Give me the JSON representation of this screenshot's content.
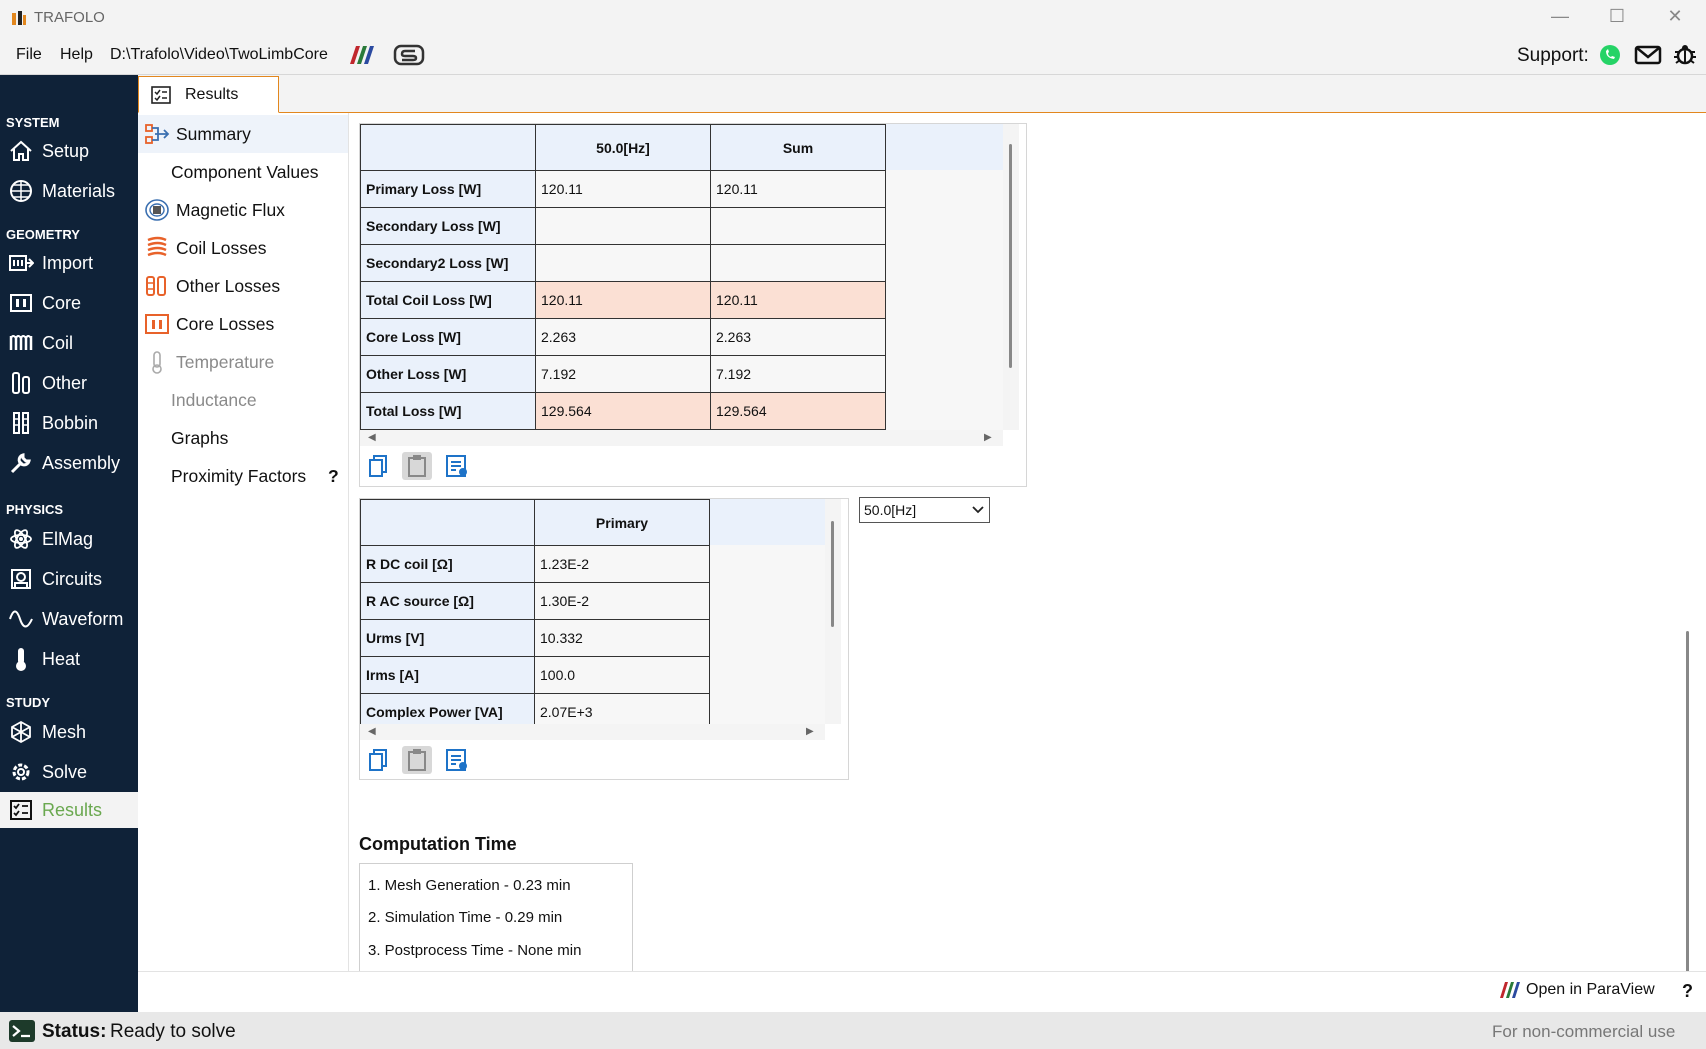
{
  "window": {
    "app_title": "TRAFOLO",
    "minimize": "—",
    "maximize": "☐",
    "close": "✕"
  },
  "menu": {
    "file": "File",
    "help": "Help",
    "path": "D:\\Trafolo\\Video\\TwoLimbCore",
    "support_label": "Support:"
  },
  "sidebar": {
    "sections": {
      "system": "SYSTEM",
      "geometry": "GEOMETRY",
      "physics": "PHYSICS",
      "study": "STUDY"
    },
    "items": {
      "setup": "Setup",
      "materials": "Materials",
      "import": "Import",
      "core": "Core",
      "coil": "Coil",
      "other": "Other",
      "bobbin": "Bobbin",
      "assembly": "Assembly",
      "elmag": "ElMag",
      "circuits": "Circuits",
      "waveform": "Waveform",
      "heat": "Heat",
      "mesh": "Mesh",
      "solve": "Solve",
      "results": "Results"
    }
  },
  "tab": {
    "label": "Results"
  },
  "subnav": {
    "summary": "Summary",
    "component_values": "Component Values",
    "magnetic_flux": "Magnetic Flux",
    "coil_losses": "Coil Losses",
    "other_losses": "Other Losses",
    "core_losses": "Core Losses",
    "temperature": "Temperature",
    "inductance": "Inductance",
    "graphs": "Graphs",
    "proximity_factors": "Proximity Factors",
    "help_mark": "?"
  },
  "loss_table": {
    "headers": [
      "50.0[Hz]",
      "Sum"
    ],
    "rows": [
      {
        "label": "Primary Loss [W]",
        "v1": "120.11",
        "v2": "120.11"
      },
      {
        "label": "Secondary Loss [W]",
        "v1": "",
        "v2": ""
      },
      {
        "label": "Secondary2 Loss [W]",
        "v1": "",
        "v2": ""
      },
      {
        "label": "Total Coil Loss [W]",
        "v1": "120.11",
        "v2": "120.11"
      },
      {
        "label": "Core Loss [W]",
        "v1": "2.263",
        "v2": "2.263"
      },
      {
        "label": "Other Loss [W]",
        "v1": "7.192",
        "v2": "7.192"
      },
      {
        "label": "Total Loss [W]",
        "v1": "129.564",
        "v2": "129.564"
      }
    ]
  },
  "component_table": {
    "headers": [
      "Primary"
    ],
    "rows": [
      {
        "label": "R DC coil [Ω]",
        "v1": "1.23E-2"
      },
      {
        "label": "R AC source [Ω]",
        "v1": "1.30E-2"
      },
      {
        "label": "Urms [V]",
        "v1": "10.332"
      },
      {
        "label": "Irms [A]",
        "v1": "100.0"
      },
      {
        "label": "Complex Power [VA]",
        "v1": "2.07E+3"
      }
    ]
  },
  "frequency_select": {
    "value": "50.0[Hz]"
  },
  "computation": {
    "title": "Computation Time",
    "lines": [
      "1. Mesh Generation -  0.23 min",
      "2. Simulation Time -  0.29 min",
      "3. Postprocess Time -  None min"
    ]
  },
  "bottom": {
    "paraview": "Open in ParaView",
    "help_mark": "?"
  },
  "status": {
    "label": "Status:",
    "text": "Ready to solve",
    "license": "For non-commercial use"
  },
  "colors": {
    "sidebar_bg": "#0f2238",
    "accent_orange": "#e2871e",
    "active_green": "#6aa84f",
    "header_blue": "#eaf1fb",
    "highlight_row": "#fbe0d4",
    "icon_orange": "#e8622a"
  }
}
